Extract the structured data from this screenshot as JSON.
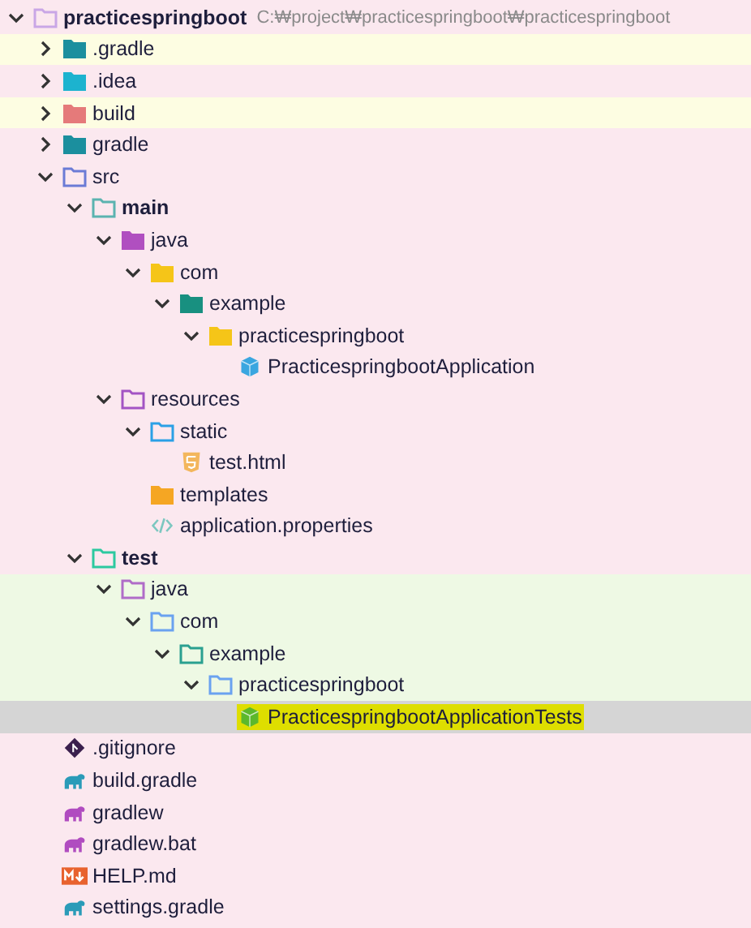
{
  "project": {
    "name": "practicespringboot",
    "path": "C:₩project₩practicespringboot₩practicespringboot",
    "kind": "project-folder",
    "expanded": true,
    "selected": false,
    "children": [
      {
        "name": ".gradle",
        "kind": "gradle-folder",
        "expanded": false,
        "selected": false,
        "ignored": true
      },
      {
        "name": ".idea",
        "kind": "idea-folder",
        "expanded": false,
        "selected": false
      },
      {
        "name": "build",
        "kind": "excluded-folder",
        "expanded": false,
        "selected": false,
        "ignored": true
      },
      {
        "name": "gradle",
        "kind": "gradle-folder",
        "expanded": false,
        "selected": false
      },
      {
        "name": "src",
        "kind": "source-root",
        "expanded": true,
        "selected": false,
        "children": [
          {
            "name": "main",
            "kind": "module-folder",
            "bold": true,
            "expanded": true,
            "selected": false,
            "children": [
              {
                "name": "java",
                "kind": "source-folder",
                "expanded": true,
                "selected": false,
                "children": [
                  {
                    "name": "com",
                    "kind": "package",
                    "expanded": true,
                    "selected": false,
                    "children": [
                      {
                        "name": "example",
                        "kind": "teal-package",
                        "expanded": true,
                        "selected": false,
                        "children": [
                          {
                            "name": "practicespringboot",
                            "kind": "package",
                            "expanded": true,
                            "selected": false,
                            "children": [
                              {
                                "name": "PracticespringbootApplication",
                                "kind": "class",
                                "selected": false
                              }
                            ]
                          }
                        ]
                      }
                    ]
                  }
                ]
              },
              {
                "name": "resources",
                "kind": "resource-folder",
                "expanded": true,
                "selected": false,
                "children": [
                  {
                    "name": "static",
                    "kind": "web-folder",
                    "expanded": true,
                    "selected": false,
                    "children": [
                      {
                        "name": "test.html",
                        "kind": "html-file",
                        "selected": false
                      }
                    ]
                  },
                  {
                    "name": "templates",
                    "kind": "template-folder",
                    "selected": false
                  },
                  {
                    "name": "application.properties",
                    "kind": "properties-file",
                    "selected": false
                  }
                ]
              }
            ]
          },
          {
            "name": "test",
            "kind": "test-root",
            "bold": true,
            "expanded": true,
            "selected": false,
            "children": [
              {
                "name": "java",
                "kind": "test-source-folder",
                "expanded": true,
                "selected": false,
                "test_scope": true,
                "children": [
                  {
                    "name": "com",
                    "kind": "test-package",
                    "expanded": true,
                    "selected": false,
                    "test_scope": true,
                    "children": [
                      {
                        "name": "example",
                        "kind": "teal-test-package",
                        "expanded": true,
                        "selected": false,
                        "test_scope": true,
                        "children": [
                          {
                            "name": "practicespringboot",
                            "kind": "test-package",
                            "expanded": true,
                            "selected": false,
                            "test_scope": true,
                            "children": [
                              {
                                "name": "PracticespringbootApplicationTests",
                                "kind": "test-class",
                                "selected": true,
                                "highlighted": true
                              }
                            ]
                          }
                        ]
                      }
                    ]
                  }
                ]
              }
            ]
          }
        ]
      },
      {
        "name": ".gitignore",
        "kind": "git-file",
        "selected": false
      },
      {
        "name": "build.gradle",
        "kind": "gradle-file",
        "selected": false
      },
      {
        "name": "gradlew",
        "kind": "gradle-script",
        "selected": false
      },
      {
        "name": "gradlew.bat",
        "kind": "gradle-script",
        "selected": false
      },
      {
        "name": "HELP.md",
        "kind": "markdown-file",
        "selected": false
      },
      {
        "name": "settings.gradle",
        "kind": "gradle-file",
        "selected": false
      }
    ]
  }
}
